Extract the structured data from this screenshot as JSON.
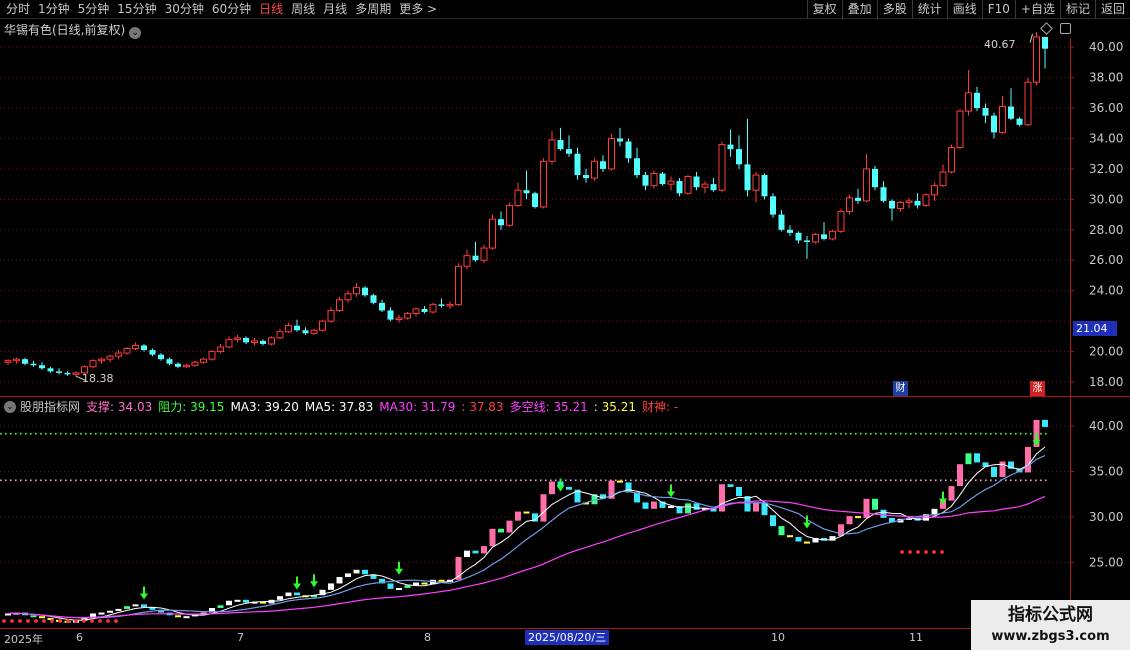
{
  "toolbar": {
    "periods": [
      "分时",
      "1分钟",
      "5分钟",
      "15分钟",
      "30分钟",
      "60分钟",
      "日线",
      "周线",
      "月线",
      "多周期",
      "更多 >"
    ],
    "active_period": "日线",
    "buttons": [
      "复权",
      "叠加",
      "多股",
      "统计",
      "画线",
      "F10",
      "+自选",
      "标记",
      "返回"
    ]
  },
  "main_panel": {
    "title": "华锡有色(日线,前复权)",
    "price_ticks": [
      "40.00",
      "38.00",
      "36.00",
      "34.00",
      "32.00",
      "30.00",
      "28.00",
      "26.00",
      "24.00",
      "20.00",
      "18.00"
    ],
    "hidden_tick": "22.00",
    "current_price_tag": "21.04",
    "max_label": "40.67",
    "min_label": "18.38",
    "badge_cai": "财",
    "badge_zhang": "涨"
  },
  "indicator_panel": {
    "legend": [
      {
        "text": "股朋指标网",
        "color": "#c8c8c8"
      },
      {
        "text": "支撑: 34.03",
        "color": "#ff6ec7"
      },
      {
        "text": "阻力: 39.15",
        "color": "#3cff3c"
      },
      {
        "text": "MA3: 39.20",
        "color": "#ffffff"
      },
      {
        "text": "MA5: 37.83",
        "color": "#ffffff"
      },
      {
        "text": "MA30: 31.79",
        "color": "#ff40ff"
      },
      {
        "text": ": 37.83",
        "color": "#ff4040"
      },
      {
        "text": "多空线: 35.21",
        "color": "#ff40ff"
      },
      {
        "text": ": 35.21",
        "color": "#ffff40"
      },
      {
        "text": "财神: -",
        "color": "#ff4040"
      }
    ],
    "ticks": [
      "40.00",
      "35.00",
      "30.00",
      "25.00"
    ]
  },
  "date_axis": {
    "labels": [
      "2025年",
      "6",
      "7",
      "8",
      "10",
      "11"
    ],
    "selected": "2025/08/20/三"
  },
  "watermark": {
    "line1": "指标公式网",
    "line2": "www.zbgs3.com"
  },
  "colors": {
    "up": "#ff3b3b",
    "down": "#54ffff",
    "grid": "#6e1010",
    "axis": "#a81818"
  },
  "chart_data": {
    "type": "candlestick",
    "ylim": [
      17.2,
      41.6
    ],
    "ohlc": [
      [
        19.3,
        19.5,
        19.1,
        19.4
      ],
      [
        19.4,
        19.6,
        19.2,
        19.5
      ],
      [
        19.5,
        19.6,
        19.1,
        19.2
      ],
      [
        19.2,
        19.4,
        19.0,
        19.1
      ],
      [
        19.1,
        19.3,
        18.8,
        18.9
      ],
      [
        18.9,
        19.0,
        18.6,
        18.7
      ],
      [
        18.7,
        18.9,
        18.5,
        18.6
      ],
      [
        18.6,
        18.7,
        18.4,
        18.5
      ],
      [
        18.5,
        18.7,
        18.38,
        18.6
      ],
      [
        18.6,
        19.1,
        18.5,
        19.0
      ],
      [
        19.0,
        19.5,
        18.9,
        19.4
      ],
      [
        19.4,
        19.6,
        19.2,
        19.5
      ],
      [
        19.5,
        19.8,
        19.3,
        19.7
      ],
      [
        19.7,
        20.1,
        19.5,
        19.9
      ],
      [
        19.9,
        20.3,
        19.8,
        20.2
      ],
      [
        20.2,
        20.6,
        20.1,
        20.4
      ],
      [
        20.4,
        20.5,
        20.0,
        20.1
      ],
      [
        20.1,
        20.2,
        19.7,
        19.8
      ],
      [
        19.8,
        19.9,
        19.4,
        19.5
      ],
      [
        19.5,
        19.6,
        19.1,
        19.2
      ],
      [
        19.2,
        19.3,
        18.9,
        19.0
      ],
      [
        19.0,
        19.2,
        18.9,
        19.1
      ],
      [
        19.1,
        19.4,
        19.0,
        19.3
      ],
      [
        19.3,
        19.6,
        19.2,
        19.5
      ],
      [
        19.5,
        20.1,
        19.4,
        20.0
      ],
      [
        20.0,
        20.5,
        19.9,
        20.3
      ],
      [
        20.3,
        21.0,
        20.2,
        20.8
      ],
      [
        20.8,
        21.1,
        20.6,
        20.9
      ],
      [
        20.9,
        21.0,
        20.5,
        20.6
      ],
      [
        20.6,
        20.9,
        20.4,
        20.7
      ],
      [
        20.7,
        20.8,
        20.4,
        20.5
      ],
      [
        20.5,
        21.0,
        20.4,
        20.9
      ],
      [
        20.9,
        21.5,
        20.8,
        21.3
      ],
      [
        21.3,
        21.9,
        21.2,
        21.7
      ],
      [
        21.7,
        22.1,
        21.3,
        21.4
      ],
      [
        21.4,
        21.6,
        21.1,
        21.2
      ],
      [
        21.2,
        21.5,
        21.1,
        21.4
      ],
      [
        21.4,
        22.1,
        21.3,
        22.0
      ],
      [
        22.0,
        22.9,
        21.9,
        22.7
      ],
      [
        22.7,
        23.6,
        22.6,
        23.4
      ],
      [
        23.4,
        24.0,
        23.2,
        23.8
      ],
      [
        23.8,
        24.5,
        23.6,
        24.2
      ],
      [
        24.2,
        24.3,
        23.6,
        23.7
      ],
      [
        23.7,
        23.8,
        23.1,
        23.2
      ],
      [
        23.2,
        23.4,
        22.6,
        22.7
      ],
      [
        22.7,
        22.9,
        22.0,
        22.1
      ],
      [
        22.1,
        22.4,
        21.9,
        22.2
      ],
      [
        22.2,
        22.6,
        22.1,
        22.5
      ],
      [
        22.5,
        22.9,
        22.3,
        22.8
      ],
      [
        22.8,
        23.0,
        22.5,
        22.6
      ],
      [
        22.6,
        23.2,
        22.5,
        23.1
      ],
      [
        23.1,
        23.5,
        22.9,
        23.0
      ],
      [
        23.0,
        23.3,
        22.8,
        23.1
      ],
      [
        23.1,
        25.8,
        23.0,
        25.6
      ],
      [
        25.6,
        26.7,
        25.4,
        26.3
      ],
      [
        26.3,
        27.2,
        25.9,
        26.0
      ],
      [
        26.0,
        27.0,
        25.8,
        26.8
      ],
      [
        26.8,
        29.0,
        26.7,
        28.7
      ],
      [
        28.7,
        29.2,
        28.0,
        28.3
      ],
      [
        28.3,
        29.8,
        28.2,
        29.6
      ],
      [
        29.6,
        31.1,
        29.5,
        30.6
      ],
      [
        30.6,
        31.9,
        30.0,
        30.4
      ],
      [
        30.4,
        30.5,
        29.4,
        29.5
      ],
      [
        29.5,
        32.7,
        29.4,
        32.5
      ],
      [
        32.5,
        34.5,
        32.3,
        33.9
      ],
      [
        33.9,
        34.7,
        33.2,
        33.3
      ],
      [
        33.3,
        34.2,
        32.8,
        33.0
      ],
      [
        33.0,
        33.4,
        31.3,
        31.6
      ],
      [
        31.6,
        32.0,
        31.1,
        31.4
      ],
      [
        31.4,
        32.7,
        31.2,
        32.5
      ],
      [
        32.5,
        32.9,
        31.8,
        32.0
      ],
      [
        32.0,
        34.3,
        31.9,
        34.0
      ],
      [
        34.0,
        34.7,
        33.5,
        33.8
      ],
      [
        33.8,
        34.0,
        32.4,
        32.7
      ],
      [
        32.7,
        33.4,
        31.4,
        31.6
      ],
      [
        31.6,
        31.8,
        30.6,
        30.9
      ],
      [
        30.9,
        31.9,
        30.7,
        31.7
      ],
      [
        31.7,
        31.8,
        30.9,
        31.0
      ],
      [
        31.0,
        31.5,
        30.6,
        31.2
      ],
      [
        31.2,
        31.4,
        30.2,
        30.4
      ],
      [
        30.4,
        31.6,
        30.3,
        31.5
      ],
      [
        31.5,
        31.8,
        30.6,
        30.8
      ],
      [
        30.8,
        31.2,
        30.4,
        31.0
      ],
      [
        31.0,
        31.4,
        30.5,
        30.6
      ],
      [
        30.6,
        33.8,
        30.5,
        33.6
      ],
      [
        33.6,
        34.6,
        32.8,
        33.3
      ],
      [
        33.3,
        34.2,
        32.0,
        32.3
      ],
      [
        32.3,
        35.3,
        30.2,
        30.6
      ],
      [
        30.6,
        31.8,
        29.8,
        31.6
      ],
      [
        31.6,
        31.7,
        30.0,
        30.2
      ],
      [
        30.2,
        30.4,
        28.8,
        29.0
      ],
      [
        29.0,
        29.3,
        27.9,
        28.0
      ],
      [
        28.0,
        28.3,
        27.6,
        27.8
      ],
      [
        27.8,
        27.9,
        27.1,
        27.3
      ],
      [
        27.3,
        27.6,
        26.1,
        27.2
      ],
      [
        27.2,
        27.8,
        27.1,
        27.7
      ],
      [
        27.7,
        28.5,
        27.3,
        27.4
      ],
      [
        27.4,
        28.0,
        27.3,
        27.9
      ],
      [
        27.9,
        29.4,
        27.8,
        29.2
      ],
      [
        29.2,
        30.3,
        29.0,
        30.1
      ],
      [
        30.1,
        30.7,
        29.7,
        29.9
      ],
      [
        29.9,
        33.0,
        29.8,
        32.0
      ],
      [
        32.0,
        32.2,
        30.6,
        30.8
      ],
      [
        30.8,
        31.2,
        29.8,
        29.9
      ],
      [
        29.9,
        30.0,
        28.6,
        29.4
      ],
      [
        29.4,
        29.9,
        29.2,
        29.8
      ],
      [
        29.8,
        30.1,
        29.4,
        29.9
      ],
      [
        29.9,
        30.4,
        29.4,
        29.6
      ],
      [
        29.6,
        30.4,
        29.5,
        30.3
      ],
      [
        30.3,
        31.1,
        29.9,
        30.9
      ],
      [
        30.9,
        32.3,
        30.8,
        31.8
      ],
      [
        31.8,
        33.6,
        31.7,
        33.4
      ],
      [
        33.4,
        35.9,
        33.3,
        35.8
      ],
      [
        35.8,
        38.5,
        35.5,
        37.0
      ],
      [
        37.0,
        37.4,
        35.8,
        36.0
      ],
      [
        36.0,
        36.3,
        35.0,
        35.5
      ],
      [
        35.5,
        35.7,
        34.0,
        34.4
      ],
      [
        34.4,
        36.8,
        34.3,
        36.1
      ],
      [
        36.1,
        37.3,
        35.2,
        35.3
      ],
      [
        35.3,
        35.4,
        34.8,
        34.9
      ],
      [
        34.9,
        38.0,
        34.8,
        37.7
      ],
      [
        37.7,
        41.0,
        37.5,
        40.67
      ],
      [
        40.67,
        40.67,
        38.6,
        39.9
      ]
    ]
  }
}
